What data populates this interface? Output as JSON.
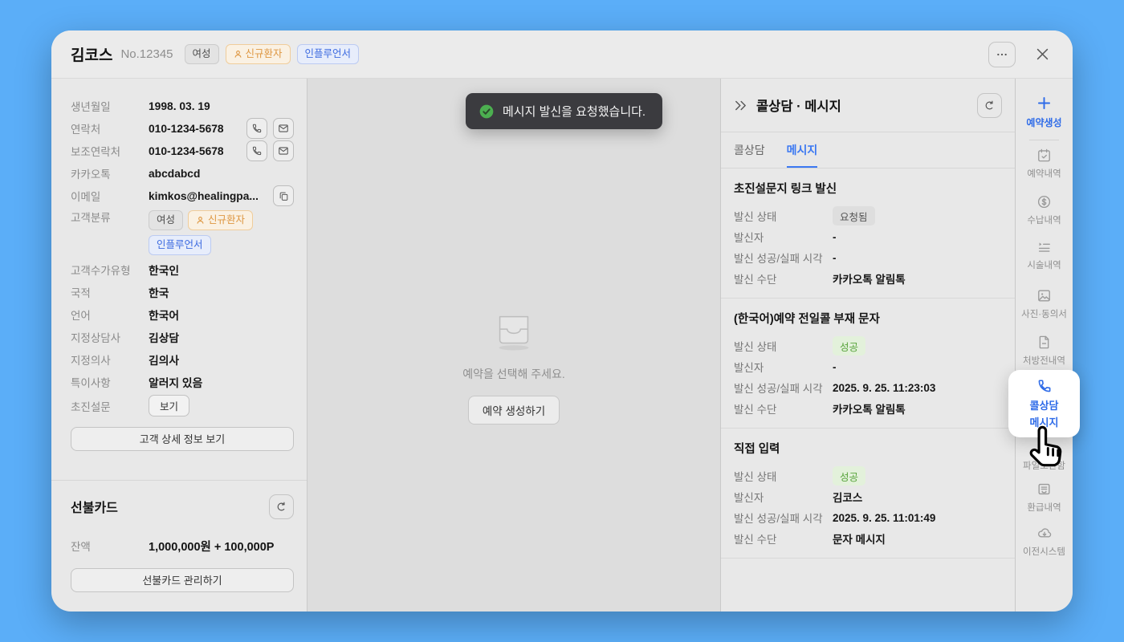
{
  "colors": {
    "page_bg": "#5BAEF8",
    "accent_blue": "#2E6BE8",
    "tab_blue": "#3B78F2",
    "badge_orange": "#DE9742",
    "badge_blue": "#3D6BE0",
    "success_green": "#58A43C",
    "toast_bg": "#3B3B3F",
    "toast_check_green": "#4CAF50"
  },
  "icons": {
    "more": "more-ellipsis",
    "close": "x",
    "collapse": "double-chevron-right",
    "refresh": "circular-arrow",
    "toast_status": "check-circle"
  },
  "header": {
    "name": "김코스",
    "number": "No.12345",
    "badges": [
      {
        "label": "여성",
        "type": "gray"
      },
      {
        "label": "신규환자",
        "type": "orange"
      },
      {
        "label": "인플루언서",
        "type": "blue"
      }
    ]
  },
  "profile": {
    "fields": [
      {
        "label": "생년월일",
        "value": "1998. 03. 19"
      },
      {
        "label": "연락처",
        "value": "010-1234-5678"
      },
      {
        "label": "보조연락처",
        "value": "010-1234-5678"
      },
      {
        "label": "카카오톡",
        "value": "abcdabcd"
      },
      {
        "label": "이메일",
        "value": "kimkos@healingpa..."
      },
      {
        "label": "고객분류",
        "badges": [
          "여성",
          "신규환자",
          "인플루언서"
        ]
      },
      {
        "label": "고객수가유형",
        "value": "한국인"
      },
      {
        "label": "국적",
        "value": "한국"
      },
      {
        "label": "언어",
        "value": "한국어"
      },
      {
        "label": "지정상담사",
        "value": "김상담"
      },
      {
        "label": "지정의사",
        "value": "김의사"
      },
      {
        "label": "특이사항",
        "value": "알러지 있음"
      },
      {
        "label": "초진설문",
        "button_label": "보기"
      }
    ],
    "detail_button": "고객 상세 정보 보기"
  },
  "prepaid_card": {
    "title": "선불카드",
    "balance_label": "잔액",
    "balance_value": "1,000,000원 + 100,000P",
    "manage_button": "선불카드 관리하기"
  },
  "toast": {
    "message": "메시지 발신을 요청했습니다."
  },
  "reservation_empty": {
    "message": "예약을 선택해 주세요.",
    "create_button": "예약 생성하기"
  },
  "message_panel": {
    "title": "콜상담 · 메시지",
    "tabs": [
      {
        "label": "콜상담",
        "active": false
      },
      {
        "label": "메시지",
        "active": true
      }
    ],
    "row_labels": {
      "status": "발신 상태",
      "sender": "발신자",
      "time": "발신 성공/실패 시각",
      "method": "발신 수단"
    },
    "messages": [
      {
        "title": "초진설문지 링크 발신",
        "status": "요청됨",
        "status_type": "gray",
        "sender": "-",
        "time": "-",
        "method": "카카오톡 알림톡"
      },
      {
        "title": "(한국어)예약 전일콜 부재 문자",
        "status": "성공",
        "status_type": "green",
        "sender": "-",
        "time": "2025. 9. 25. 11:23:03",
        "method": "카카오톡 알림톡"
      },
      {
        "title": "직접 입력",
        "status": "성공",
        "status_type": "green",
        "sender": "김코스",
        "time": "2025. 9. 25. 11:01:49",
        "method": "문자 메시지"
      }
    ]
  },
  "sidebar": {
    "items": [
      {
        "label": "예약생성",
        "icon": "plus"
      },
      {
        "label": "예약내역",
        "icon": "calendar-check"
      },
      {
        "label": "수납내역",
        "icon": "dollar-circle"
      },
      {
        "label": "시술내역",
        "icon": "procedure-list"
      },
      {
        "label": "사진·동의서",
        "icon": "photo-consent"
      },
      {
        "label": "처방전내역",
        "icon": "prescription"
      },
      {
        "label_line1": "콜상담",
        "label_line2": "메시지",
        "icon": "phone",
        "active": true
      },
      {
        "label": "파일보관함",
        "icon": "file-box"
      },
      {
        "label": "환급내역",
        "icon": "refund"
      },
      {
        "label": "이전시스템",
        "icon": "cloud-download"
      }
    ]
  }
}
